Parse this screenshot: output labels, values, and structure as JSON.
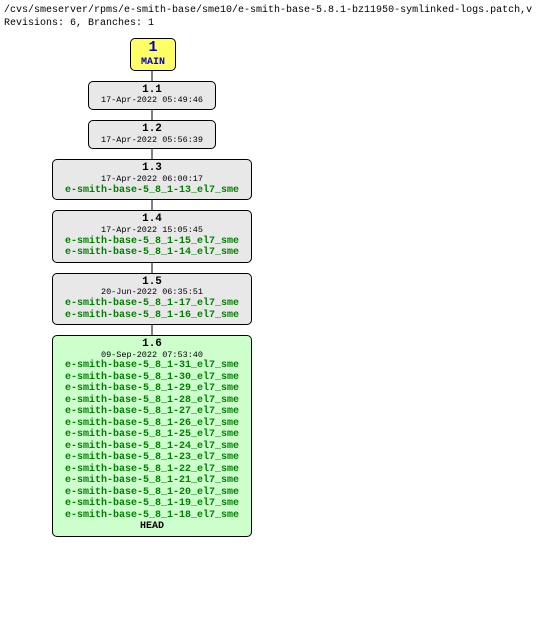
{
  "header": {
    "path": "/cvs/smeserver/rpms/e-smith-base/sme10/e-smith-base-5.8.1-bz11950-symlinked-logs.patch,v",
    "revisions_label": "Revisions: 6, Branches: 1"
  },
  "main": {
    "num": "1",
    "label": "MAIN"
  },
  "nodes": {
    "r11": {
      "version": "1.1",
      "date": "17-Apr-2022 05:49:46"
    },
    "r12": {
      "version": "1.2",
      "date": "17-Apr-2022 05:56:39"
    },
    "r13": {
      "version": "1.3",
      "date": "17-Apr-2022 06:00:17",
      "tags": [
        "e-smith-base-5_8_1-13_el7_sme"
      ]
    },
    "r14": {
      "version": "1.4",
      "date": "17-Apr-2022 15:05:45",
      "tags": [
        "e-smith-base-5_8_1-15_el7_sme",
        "e-smith-base-5_8_1-14_el7_sme"
      ]
    },
    "r15": {
      "version": "1.5",
      "date": "20-Jun-2022 06:35:51",
      "tags": [
        "e-smith-base-5_8_1-17_el7_sme",
        "e-smith-base-5_8_1-16_el7_sme"
      ]
    },
    "r16": {
      "version": "1.6",
      "date": "09-Sep-2022 07:53:40",
      "tags": [
        "e-smith-base-5_8_1-31_el7_sme",
        "e-smith-base-5_8_1-30_el7_sme",
        "e-smith-base-5_8_1-29_el7_sme",
        "e-smith-base-5_8_1-28_el7_sme",
        "e-smith-base-5_8_1-27_el7_sme",
        "e-smith-base-5_8_1-26_el7_sme",
        "e-smith-base-5_8_1-25_el7_sme",
        "e-smith-base-5_8_1-24_el7_sme",
        "e-smith-base-5_8_1-23_el7_sme",
        "e-smith-base-5_8_1-22_el7_sme",
        "e-smith-base-5_8_1-21_el7_sme",
        "e-smith-base-5_8_1-20_el7_sme",
        "e-smith-base-5_8_1-19_el7_sme",
        "e-smith-base-5_8_1-18_el7_sme"
      ],
      "head": "HEAD"
    }
  }
}
